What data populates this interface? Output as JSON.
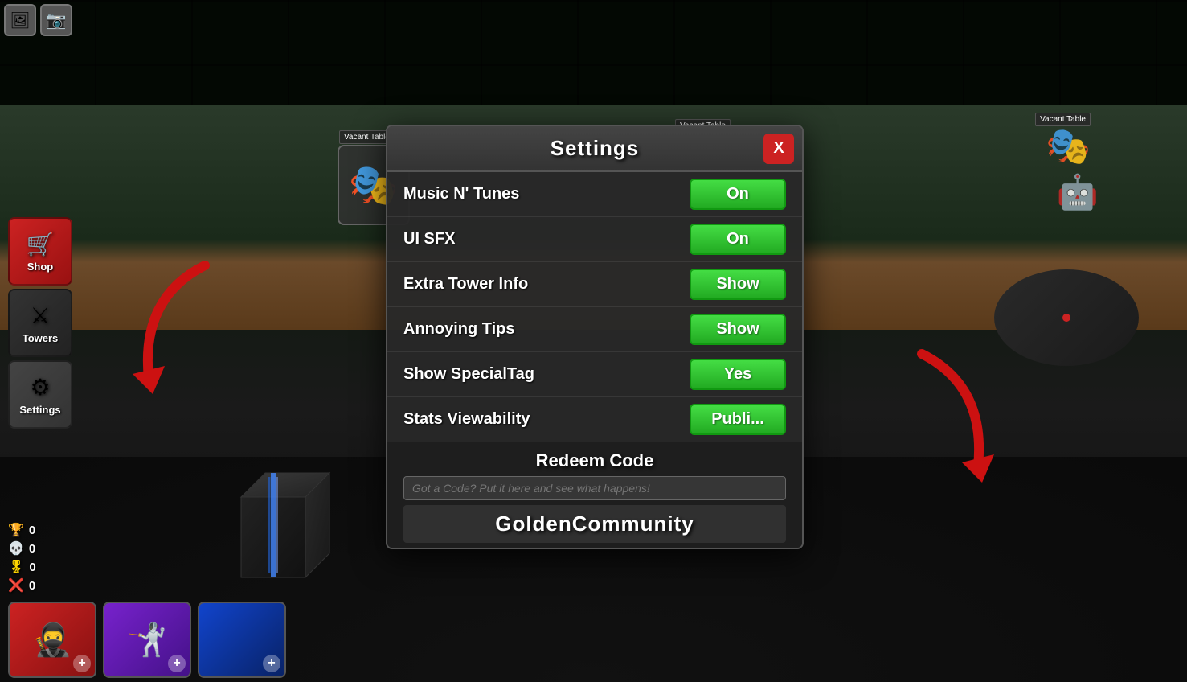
{
  "modal": {
    "title": "Settings",
    "close_label": "X",
    "settings": [
      {
        "label": "Music N' Tunes",
        "value": "On",
        "type": "green"
      },
      {
        "label": "UI SFX",
        "value": "On",
        "type": "green"
      },
      {
        "label": "Extra Tower Info",
        "value": "Show",
        "type": "green-show"
      },
      {
        "label": "Annoying Tips",
        "value": "Show",
        "type": "green-show"
      },
      {
        "label": "Show SpecialTag",
        "value": "Yes",
        "type": "green-yes"
      },
      {
        "label": "Stats Viewability",
        "value": "Publi...",
        "type": "green-pub"
      }
    ],
    "redeem": {
      "title": "Redeem Code",
      "placeholder": "Got a Code? Put it here and see what happens!",
      "code": "GoldenCommunity"
    }
  },
  "sidebar": {
    "shop_label": "Shop",
    "towers_label": "Towers",
    "settings_label": "Settings",
    "shop_icon": "🛒",
    "towers_icon": "⚔",
    "settings_icon": "⚙"
  },
  "stats": [
    {
      "icon": "🏆",
      "value": "0"
    },
    {
      "icon": "💀",
      "value": "0"
    },
    {
      "icon": "🎖",
      "value": "0"
    },
    {
      "icon": "❌",
      "value": "0"
    }
  ],
  "vacant_labels": [
    "Vacant Table",
    "Vacant Table",
    "Vacant Table"
  ],
  "top_icons": [
    "🖼",
    "📷"
  ],
  "bottom_cards": [
    {
      "type": "char1"
    },
    {
      "type": "char2"
    },
    {
      "type": "char3"
    }
  ],
  "colors": {
    "btn_green": "#22cc22",
    "btn_red": "#cc2222",
    "modal_bg": "rgba(40,40,40,0.97)"
  }
}
